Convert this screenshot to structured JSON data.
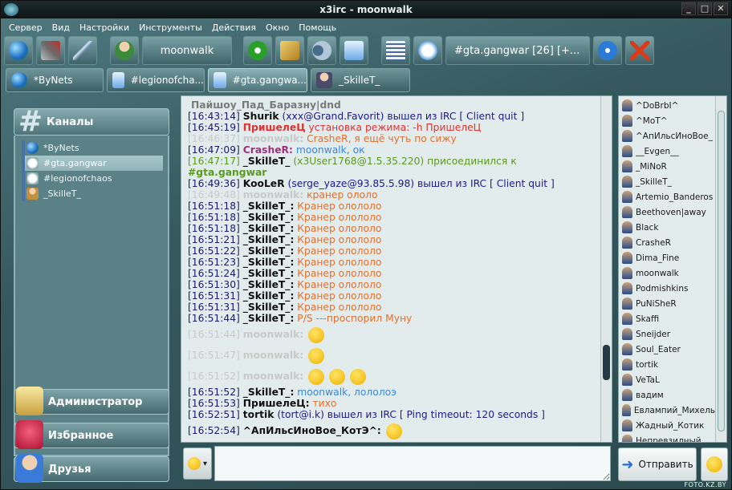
{
  "window": {
    "title": "x3irc - moonwalk",
    "minimize": "_",
    "maximize": "□",
    "close": "✕"
  },
  "menu": [
    "Сервер",
    "Вид",
    "Настройки",
    "Инструменты",
    "Действия",
    "Окно",
    "Помощь"
  ],
  "toolbar": {
    "nick": "moonwalk",
    "channel_info": "#gta.gangwar [26] [+..."
  },
  "tabs": [
    "*ByNets",
    "#legionofcha...",
    "#gta.gangwa...",
    "_SkilleT_"
  ],
  "sidebar": {
    "channels_label": "Каналы",
    "channels": [
      "*ByNets",
      "#gta.gangwar",
      "#legionofchaos",
      "_SkilleT_"
    ],
    "admin_label": "Администратор",
    "favorites_label": "Избранное",
    "friends_label": "Друзья"
  },
  "chat": {
    "lines": [
      {
        "ts": "",
        "nick": "",
        "text": "Пайшоу_Пад_Баразну|dnd",
        "old": true,
        "cls": "t-gray"
      },
      {
        "ts": "[16:43:14]",
        "nick": "Shurik",
        "text": " (xxx@Grand.Favorit) вышел из IRC [ Client quit ]",
        "cls": "t-blue"
      },
      {
        "ts": "[16:45:19]",
        "nick": "ПришелеЦ",
        "text": " установка режима: -h ПришелеЦ",
        "cls": "t-red",
        "nickcls": "t-red"
      },
      {
        "ts": "[16:46:37]",
        "nick": "moonwalk:",
        "text": " CrasheR, я ещё чуть по сижу",
        "old": true,
        "cls": "t-orange"
      },
      {
        "ts": "[16:47:09]",
        "nick": "CrasheR:",
        "text": " moonwalk, ок",
        "cls": "t-sky",
        "nickcls": "t-mag"
      },
      {
        "ts": "[16:47:17]",
        "nick": "_SkilleT_",
        "text": " (x3User1768@1.5.35.220) присоединился к",
        "cls": "t-green",
        "tscls": "t-green"
      },
      {
        "ts": "",
        "nick": "",
        "text": "  #gta.gangwar",
        "cls": "t-green",
        "bold": true
      },
      {
        "ts": "[16:49:36]",
        "nick": "KooLeR",
        "text": " (serge_yaze@93.85.5.98) вышел из IRC [ Client quit ]",
        "cls": "t-blue"
      },
      {
        "ts": "[16:49:48]",
        "nick": "moonwalk:",
        "text": " кранер ололо",
        "old": true,
        "cls": "t-orange"
      },
      {
        "ts": "[16:51:18]",
        "nick": "_SkilleT_:",
        "text": " Кранер олололо",
        "cls": "t-orange"
      },
      {
        "ts": "[16:51:18]",
        "nick": "_SkilleT_:",
        "text": " Кранер олололо",
        "cls": "t-orange"
      },
      {
        "ts": "[16:51:18]",
        "nick": "_SkilleT_:",
        "text": " Кранер олололо",
        "cls": "t-orange"
      },
      {
        "ts": "[16:51:21]",
        "nick": "_SkilleT_:",
        "text": " Кранер олололо",
        "cls": "t-orange"
      },
      {
        "ts": "[16:51:22]",
        "nick": "_SkilleT_:",
        "text": " Кранер олололо",
        "cls": "t-orange"
      },
      {
        "ts": "[16:51:23]",
        "nick": "_SkilleT_:",
        "text": " Кранер олололо",
        "cls": "t-orange"
      },
      {
        "ts": "[16:51:24]",
        "nick": "_SkilleT_:",
        "text": " Кранер олололо",
        "cls": "t-orange"
      },
      {
        "ts": "[16:51:30]",
        "nick": "_SkilleT_:",
        "text": " Кранер олололо",
        "cls": "t-orange"
      },
      {
        "ts": "[16:51:31]",
        "nick": "_SkilleT_:",
        "text": " Кранер олололо",
        "cls": "t-orange"
      },
      {
        "ts": "[16:51:31]",
        "nick": "_SkilleT_:",
        "text": " Кранер олололо",
        "cls": "t-orange"
      },
      {
        "ts": "[16:51:44]",
        "nick": "_SkilleT_:",
        "text": " P/S  ---проспорил Муну",
        "cls": "t-orange"
      },
      {
        "ts": "[16:51:44]",
        "nick": "moonwalk:",
        "text": "",
        "old": true,
        "smiles": 1
      },
      {
        "ts": "[16:51:47]",
        "nick": "moonwalk:",
        "text": "",
        "old": true,
        "smiles": 1
      },
      {
        "ts": "[16:51:52]",
        "nick": "moonwalk:",
        "text": "",
        "old": true,
        "smiles": 3
      },
      {
        "ts": "[16:51:52]",
        "nick": "_SkilleT_:",
        "text": " moonwalk, лололоэ",
        "cls": "t-sky",
        "tail": ", лололоэ"
      },
      {
        "ts": "[16:51:53]",
        "nick": "ПришелеЦ:",
        "text": " тихо",
        "cls": "t-orange"
      },
      {
        "ts": "[16:52:51]",
        "nick": "tortik",
        "text": " (tort@i.k) вышел из IRC [ Ping timeout: 120 seconds ]",
        "cls": "t-blue"
      },
      {
        "ts": "[16:52:54]",
        "nick": "^АпИльсИноВое_КотЭ^:",
        "text": "",
        "smiles": 1
      }
    ]
  },
  "users": [
    "^DoBrbI^",
    "^MoT^",
    "^АпИльсИноВое_",
    "__Evgen__",
    "_MiNoR",
    "_SkilleT_",
    "Artemio_Banderos",
    "Beethoven|away",
    "Black",
    "CrasheR",
    "Dima_Fine",
    "moonwalk",
    "Podmishkins",
    "PuNiSheR",
    "Skaffi",
    "Sneijder",
    "Soul_Eater",
    "tortik",
    "VeTaL",
    "вадим",
    "Евлампий_Михель",
    "Жадный_Котик",
    "Непревзилный"
  ],
  "input": {
    "placeholder": ""
  },
  "send_label": "Отправить",
  "watermark": "FOTO.KZ.BY",
  "colors": {
    "accent": "#4e7479",
    "chat_bg": "#e3ecec"
  }
}
